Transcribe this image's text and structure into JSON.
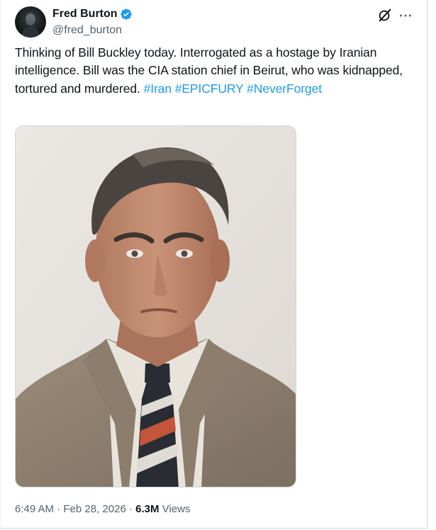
{
  "tweet": {
    "author": {
      "display_name": "Fred Burton",
      "handle": "@fred_burton",
      "verified": true,
      "avatar_icon": "avatar-photo"
    },
    "text_parts": [
      "Thinking of Bill Buckley today.  Interrogated as a hostage by Iranian intelligence.  Bill was the CIA station chief in Beirut, who was kidnapped, tortured and murdered.   "
    ],
    "hashtags": [
      "#Iran",
      "#EPICFURY",
      "#NeverForget"
    ],
    "image": {
      "alt_subject": "portrait photo"
    },
    "timestamp": "6:49 AM",
    "date": "Feb 28, 2026",
    "separator": "·",
    "views_count": "6.3M",
    "views_label": "Views",
    "icons": {
      "grok": "grok-icon",
      "more": "more-options-icon",
      "verified": "verified-badge-icon"
    },
    "colors": {
      "link": "#1d9bf0",
      "secondary_text": "#536471",
      "primary_text": "#0f1419"
    }
  }
}
